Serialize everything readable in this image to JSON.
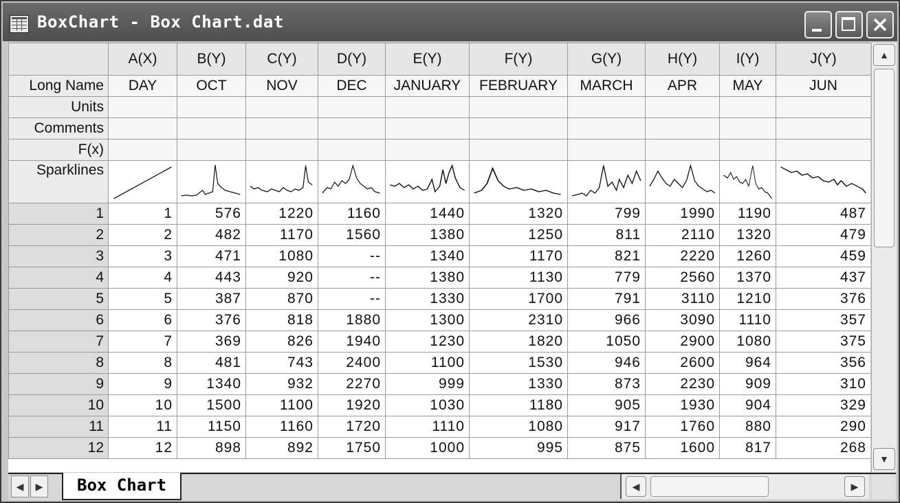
{
  "window": {
    "title": "BoxChart - Box Chart.dat",
    "icon": "worksheet-icon",
    "controls": [
      "minimize-icon",
      "maximize-icon",
      "close-icon"
    ]
  },
  "columns": [
    {
      "header": "A(X)",
      "long_name": "DAY"
    },
    {
      "header": "B(Y)",
      "long_name": "OCT"
    },
    {
      "header": "C(Y)",
      "long_name": "NOV"
    },
    {
      "header": "D(Y)",
      "long_name": "DEC"
    },
    {
      "header": "E(Y)",
      "long_name": "JANUARY"
    },
    {
      "header": "F(Y)",
      "long_name": "FEBRUARY"
    },
    {
      "header": "G(Y)",
      "long_name": "MARCH"
    },
    {
      "header": "H(Y)",
      "long_name": "APR"
    },
    {
      "header": "I(Y)",
      "long_name": "MAY"
    },
    {
      "header": "J(Y)",
      "long_name": "JUN"
    }
  ],
  "row_labels": {
    "long_name": "Long Name",
    "units": "Units",
    "comments": "Comments",
    "fx": "F(x)",
    "sparklines": "Sparklines"
  },
  "rows": [
    {
      "index": "1",
      "cells": [
        "1",
        "576",
        "1220",
        "1160",
        "1440",
        "1320",
        "799",
        "1990",
        "1190",
        "487"
      ]
    },
    {
      "index": "2",
      "cells": [
        "2",
        "482",
        "1170",
        "1560",
        "1380",
        "1250",
        "811",
        "2110",
        "1320",
        "479"
      ]
    },
    {
      "index": "3",
      "cells": [
        "3",
        "471",
        "1080",
        "--",
        "1340",
        "1170",
        "821",
        "2220",
        "1260",
        "459"
      ]
    },
    {
      "index": "4",
      "cells": [
        "4",
        "443",
        "920",
        "--",
        "1380",
        "1130",
        "779",
        "2560",
        "1370",
        "437"
      ]
    },
    {
      "index": "5",
      "cells": [
        "5",
        "387",
        "870",
        "--",
        "1330",
        "1700",
        "791",
        "3110",
        "1210",
        "376"
      ]
    },
    {
      "index": "6",
      "cells": [
        "6",
        "376",
        "818",
        "1880",
        "1300",
        "2310",
        "966",
        "3090",
        "1110",
        "357"
      ]
    },
    {
      "index": "7",
      "cells": [
        "7",
        "369",
        "826",
        "1940",
        "1230",
        "1820",
        "1050",
        "2900",
        "1080",
        "375"
      ]
    },
    {
      "index": "8",
      "cells": [
        "8",
        "481",
        "743",
        "2400",
        "1100",
        "1530",
        "946",
        "2600",
        "964",
        "356"
      ]
    },
    {
      "index": "9",
      "cells": [
        "9",
        "1340",
        "932",
        "2270",
        "999",
        "1330",
        "873",
        "2230",
        "909",
        "310"
      ]
    },
    {
      "index": "10",
      "cells": [
        "10",
        "1500",
        "1100",
        "1920",
        "1030",
        "1180",
        "905",
        "1930",
        "904",
        "329"
      ]
    },
    {
      "index": "11",
      "cells": [
        "11",
        "1150",
        "1160",
        "1720",
        "1110",
        "1080",
        "917",
        "1760",
        "880",
        "290"
      ]
    },
    {
      "index": "12",
      "cells": [
        "12",
        "898",
        "892",
        "1750",
        "1000",
        "995",
        "875",
        "1600",
        "817",
        "268"
      ]
    }
  ],
  "sheet_tab": {
    "label": "Box Chart"
  }
}
